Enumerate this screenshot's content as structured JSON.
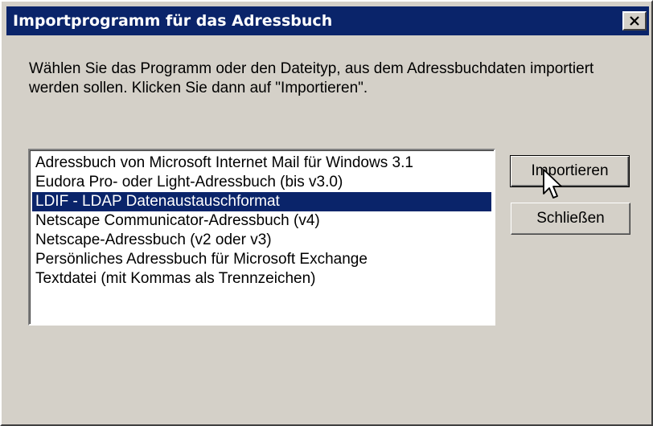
{
  "window": {
    "title": "Importprogramm für das Adressbuch"
  },
  "description": "Wählen Sie das Programm oder den Dateityp, aus dem Adressbuchdaten importiert werden sollen. Klicken Sie dann auf \"Importieren\".",
  "list": {
    "items": [
      "Adressbuch von Microsoft Internet Mail für Windows 3.1",
      "Eudora Pro- oder Light-Adressbuch (bis v3.0)",
      "LDIF - LDAP Datenaustauschformat",
      "Netscape Communicator-Adressbuch (v4)",
      "Netscape-Adressbuch (v2 oder v3)",
      "Persönliches Adressbuch für Microsoft Exchange",
      "Textdatei (mit Kommas als Trennzeichen)"
    ],
    "selected_index": 2
  },
  "buttons": {
    "import_label": "Importieren",
    "close_label": "Schließen"
  },
  "icons": {
    "close": "close-icon",
    "cursor": "mouse-pointer-icon"
  },
  "colors": {
    "titlebar": "#0a246a",
    "selection": "#0a246a",
    "face": "#d4d0c8"
  }
}
